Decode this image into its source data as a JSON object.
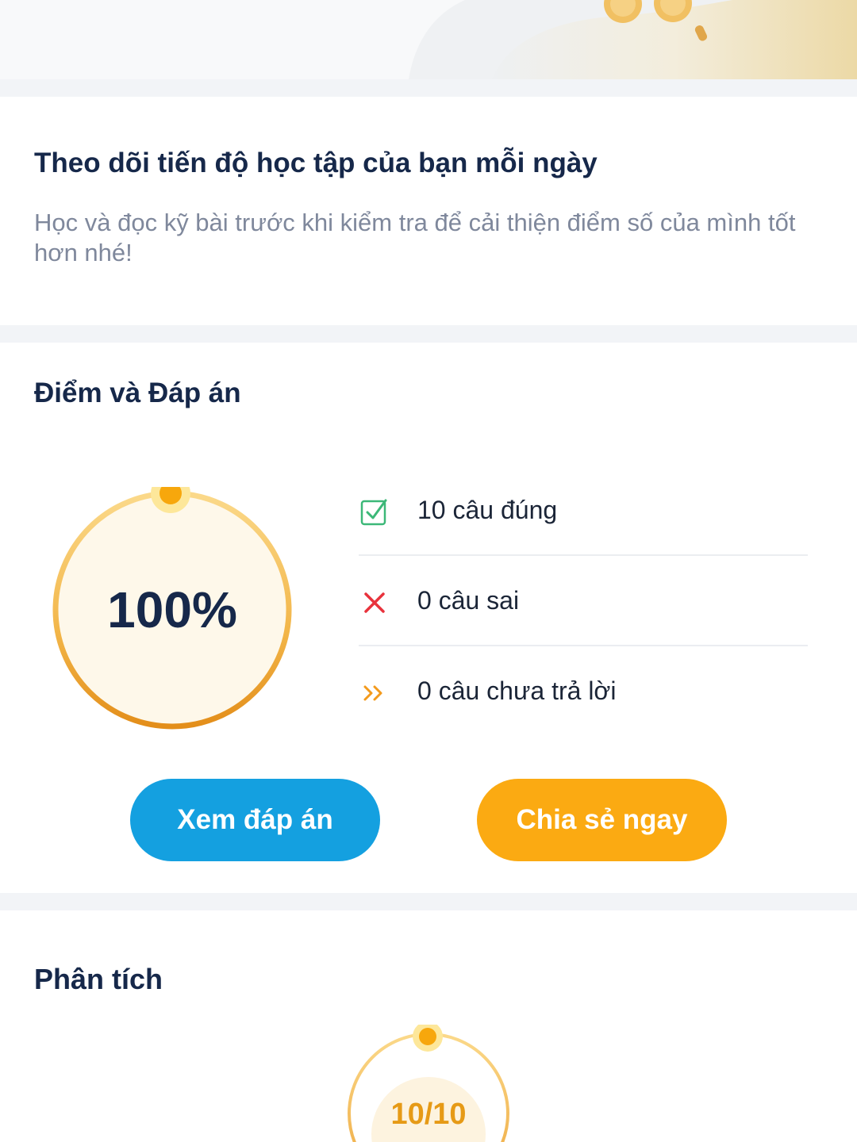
{
  "progress_card": {
    "title": "Theo dõi tiến độ học tập của bạn mỗi ngày",
    "description": "Học và đọc kỹ bài trước khi kiểm tra để cải thiện điểm số của mình tốt hơn nhé!"
  },
  "score_card": {
    "title": "Điểm và Đáp án",
    "score_percent": "100%",
    "score_fraction": 1.0,
    "stats": [
      {
        "icon": "checkbox-check-icon",
        "label": "10 câu đúng",
        "color": "#3cb878"
      },
      {
        "icon": "close-icon",
        "label": "0 câu sai",
        "color": "#e8323c"
      },
      {
        "icon": "double-chevron-right-icon",
        "label": "0 câu chưa trả lời",
        "color": "#f39a1c"
      }
    ],
    "buttons": {
      "view_answers": "Xem đáp án",
      "share": "Chia sẻ ngay"
    }
  },
  "analysis_card": {
    "title": "Phân tích",
    "score": "10/10"
  },
  "colors": {
    "primary_blue": "#14a0e0",
    "accent_orange": "#fbaa12",
    "heading": "#16284a",
    "muted_text": "#7f889c",
    "ring_gold": "#f3b030"
  }
}
